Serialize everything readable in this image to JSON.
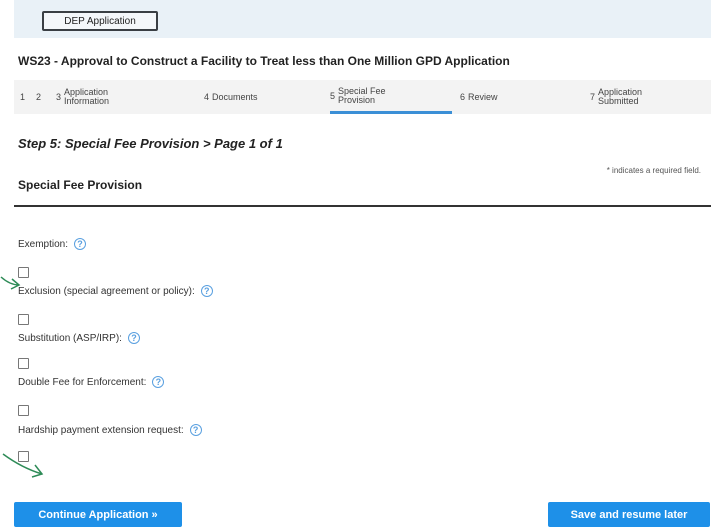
{
  "header": {
    "dep_button": "DEP Application"
  },
  "application_title": "WS23 - Approval to Construct a Facility to Treat less than One Million GPD Application",
  "steps": [
    {
      "num": "1",
      "label": ""
    },
    {
      "num": "2",
      "label": ""
    },
    {
      "num": "3",
      "label": "Application Information"
    },
    {
      "num": "4",
      "label": "Documents"
    },
    {
      "num": "5",
      "label": "Special Fee Provision"
    },
    {
      "num": "6",
      "label": "Review"
    },
    {
      "num": "7",
      "label": "Application Submitted"
    }
  ],
  "step_title": "Step 5: Special Fee Provision > Page 1 of 1",
  "required_note": "* indicates a required field.",
  "section_title": "Special Fee Provision",
  "fields": [
    {
      "label": "Exemption:"
    },
    {
      "label": "Exclusion (special agreement or policy):"
    },
    {
      "label": "Substitution (ASP/IRP):"
    },
    {
      "label": "Double Fee for Enforcement:"
    },
    {
      "label": "Hardship payment extension request:"
    }
  ],
  "help_icon_glyph": "?",
  "buttons": {
    "continue": "Continue Application »",
    "save": "Save and resume later"
  },
  "colors": {
    "accent": "#1e90e8",
    "annotation_arrow": "#2e8b57"
  }
}
